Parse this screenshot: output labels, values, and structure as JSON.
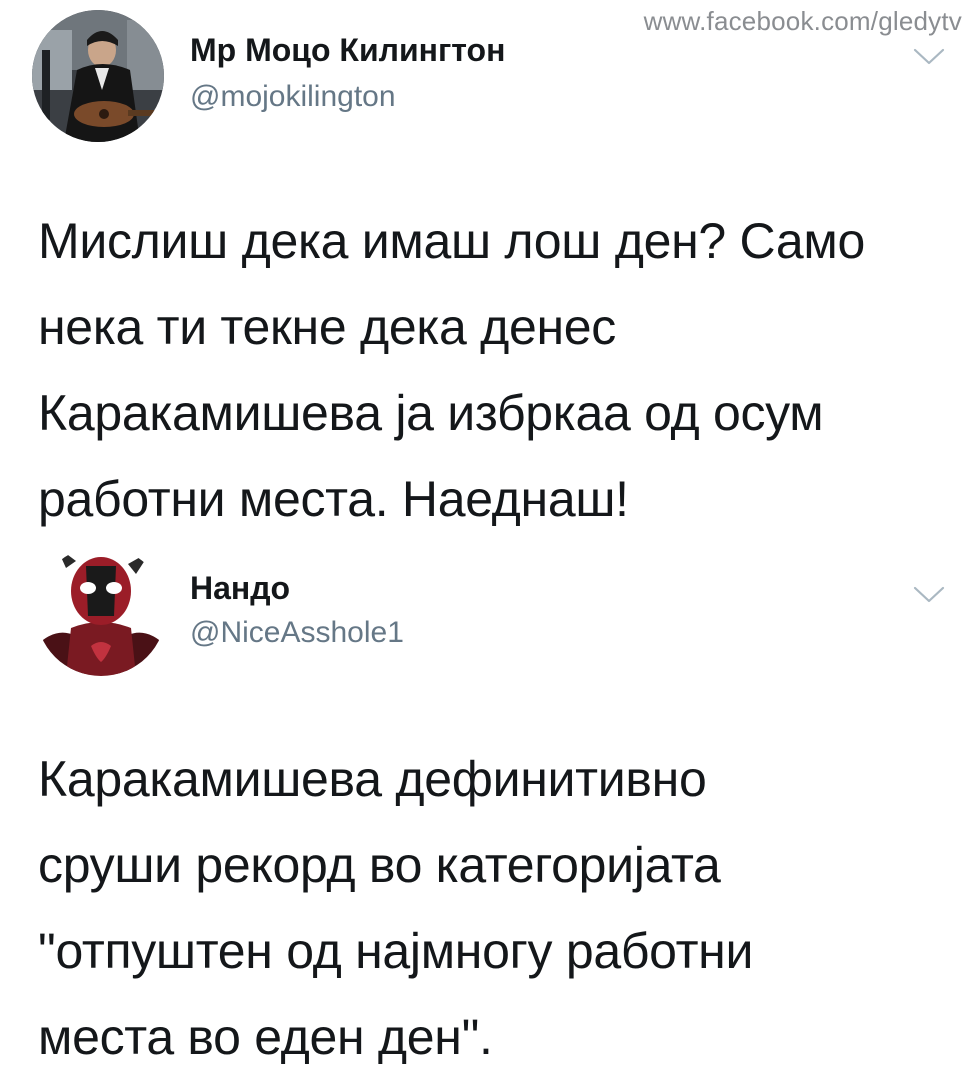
{
  "watermark": "www.facebook.com/gledytv",
  "tweets": [
    {
      "display_name": "Мр Моцо Килингтон",
      "handle": "@mojokilington",
      "avatar_icon": "musician-photo-avatar",
      "text": "Мислиш дека имаш лош ден? Само\nнека ти текне дека денес\nКаракамишева ја избркаа од осум\nработни места. Наеднаш!"
    },
    {
      "display_name": "Нандо",
      "handle": "@NiceAsshole1",
      "avatar_icon": "deadpool-avatar",
      "text": "Каракамишева дефинитивно\nсруши рекорд во категоријата\n\"отпуштен од најмногу работни\nместа во еден ден\"."
    }
  ],
  "colors": {
    "text": "#14171a",
    "secondary": "#657786",
    "watermark": "#8a8d91",
    "chevron": "#aab8c2"
  }
}
